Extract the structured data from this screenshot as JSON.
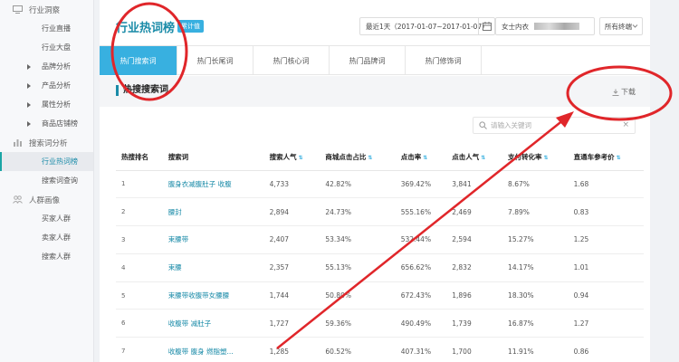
{
  "sidebar": {
    "groups": [
      {
        "label": "行业洞察",
        "icon": "monitor-icon",
        "items": [
          {
            "label": "行业直播",
            "arrow": false
          },
          {
            "label": "行业大盘",
            "arrow": false
          },
          {
            "label": "品牌分析",
            "arrow": true
          },
          {
            "label": "产品分析",
            "arrow": true
          },
          {
            "label": "属性分析",
            "arrow": true
          },
          {
            "label": "商品店铺榜",
            "arrow": true
          }
        ]
      },
      {
        "label": "搜索词分析",
        "icon": "bar-chart-icon",
        "items": [
          {
            "label": "行业热词榜",
            "arrow": false,
            "active": true
          },
          {
            "label": "搜索词查询",
            "arrow": false
          }
        ]
      },
      {
        "label": "人群画像",
        "icon": "people-icon",
        "items": [
          {
            "label": "买家人群",
            "arrow": false
          },
          {
            "label": "卖家人群",
            "arrow": false
          },
          {
            "label": "搜索人群",
            "arrow": false
          }
        ]
      }
    ]
  },
  "header": {
    "title": "行业热词榜",
    "badge": "累计值",
    "date_range": "最近1天（2017-01-07~2017-01-07）",
    "category": "女士内衣",
    "terminal": "所有终端"
  },
  "tabs": [
    {
      "label": "热门搜索词",
      "active": true
    },
    {
      "label": "热门长尾词"
    },
    {
      "label": "热门核心词"
    },
    {
      "label": "热门品牌词"
    },
    {
      "label": "热门修饰词"
    }
  ],
  "section": {
    "title": "热搜搜索词",
    "download_label": "下载"
  },
  "search": {
    "placeholder": "请输入关键词"
  },
  "table": {
    "columns": [
      {
        "label": "热搜排名",
        "sortable": false
      },
      {
        "label": "搜索词",
        "sortable": false
      },
      {
        "label": "搜索人气",
        "sortable": true
      },
      {
        "label": "商城点击占比",
        "sortable": true
      },
      {
        "label": "点击率",
        "sortable": true
      },
      {
        "label": "点击人气",
        "sortable": true
      },
      {
        "label": "支付转化率",
        "sortable": true
      },
      {
        "label": "直通车参考价",
        "sortable": true
      }
    ],
    "rows": [
      [
        "1",
        "腹身衣减腹肚子 收腹",
        "4,733",
        "42.82%",
        "369.42%",
        "3,841",
        "8.67%",
        "1.68"
      ],
      [
        "2",
        "腰封",
        "2,894",
        "24.73%",
        "555.16%",
        "2,469",
        "7.89%",
        "0.83"
      ],
      [
        "3",
        "束腰带",
        "2,407",
        "53.34%",
        "532.44%",
        "2,594",
        "15.27%",
        "1.25"
      ],
      [
        "4",
        "束腰",
        "2,357",
        "55.13%",
        "656.62%",
        "2,832",
        "14.17%",
        "1.01"
      ],
      [
        "5",
        "束腰带收腹带女腰腰",
        "1,744",
        "50.80%",
        "672.43%",
        "1,896",
        "18.30%",
        "0.94"
      ],
      [
        "6",
        "收腹带 减肚子",
        "1,727",
        "59.36%",
        "490.49%",
        "1,739",
        "16.87%",
        "1.27"
      ],
      [
        "7",
        "收腹带 腹身 燃脂塑...",
        "1,285",
        "60.52%",
        "407.31%",
        "1,700",
        "11.91%",
        "0.86"
      ]
    ]
  },
  "colors": {
    "accent": "#38b0e0",
    "link": "#1a8ba8",
    "annotation": "#e0262a"
  }
}
